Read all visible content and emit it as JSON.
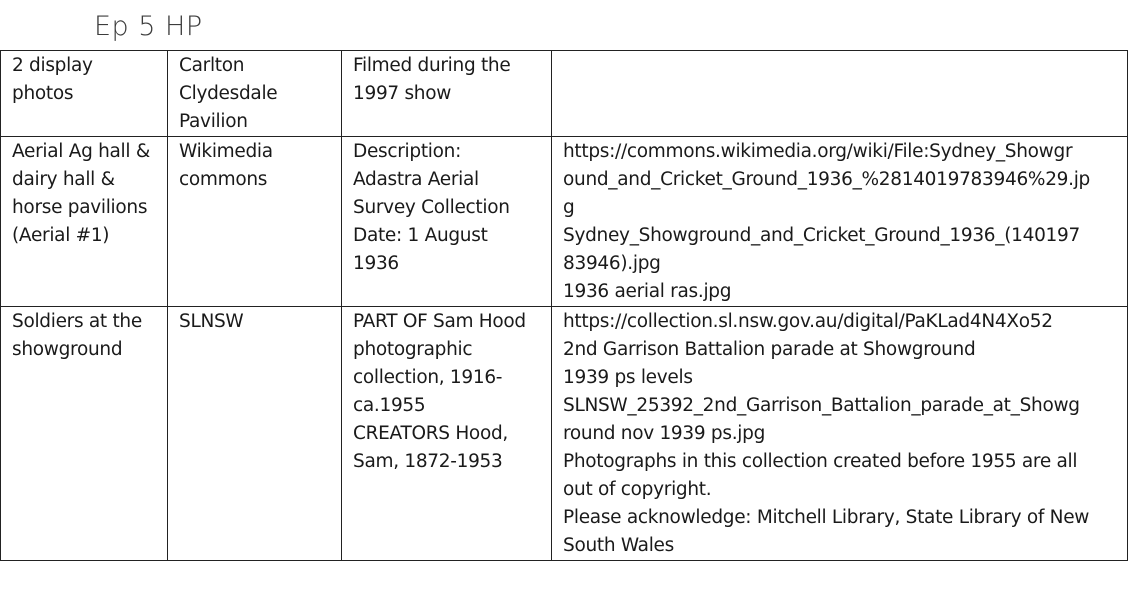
{
  "heading": "Ep 5 HP",
  "rows": [
    {
      "item": [
        "2 display",
        "photos"
      ],
      "source": [
        "Carlton",
        "Clydesdale",
        "Pavilion"
      ],
      "description": [
        "Filmed during the",
        "1997 show"
      ],
      "links": []
    },
    {
      "item": [
        "Aerial Ag hall &",
        "dairy hall &",
        "horse pavilions",
        "(Aerial #1)"
      ],
      "source": [
        "Wikimedia",
        "commons"
      ],
      "description": [
        "Description:",
        "Adastra Aerial",
        "Survey Collection",
        "Date: 1 August",
        "1936"
      ],
      "links": [
        "https://commons.wikimedia.org/wiki/File:Sydney_Showgr",
        "ound_and_Cricket_Ground_1936_%2814019783946%29.jp",
        "g",
        "Sydney_Showground_and_Cricket_Ground_1936_(140197",
        "83946).jpg",
        "1936 aerial ras.jpg"
      ]
    },
    {
      "item": [
        "Soldiers at the",
        "showground"
      ],
      "source": [
        "SLNSW"
      ],
      "description": [
        "PART OF Sam Hood",
        "photographic",
        "collection, 1916-",
        "ca.1955",
        "CREATORS Hood,",
        "Sam, 1872-1953"
      ],
      "links": [
        "https://collection.sl.nsw.gov.au/digital/PaKLad4N4Xo52",
        "2nd Garrison Battalion parade at Showground",
        "1939 ps levels",
        "SLNSW_25392_2nd_Garrison_Battalion_parade_at_Showg",
        "round nov 1939 ps.jpg",
        "Photographs in this collection created before 1955 are all",
        "out of copyright.",
        "Please acknowledge: Mitchell Library, State Library of New",
        "South Wales"
      ]
    }
  ]
}
